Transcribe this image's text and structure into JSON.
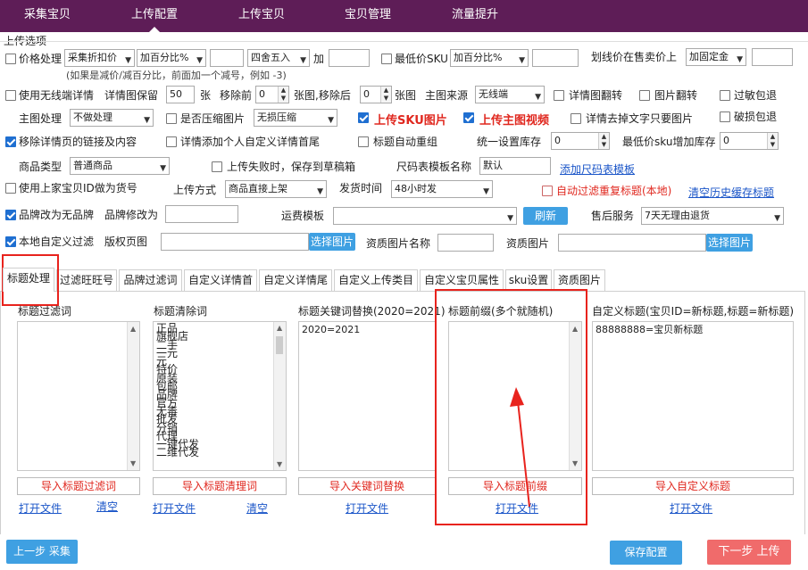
{
  "nav": {
    "tabs": [
      "采集宝贝",
      "上传配置",
      "上传宝贝",
      "宝贝管理",
      "流量提升"
    ],
    "active": 1
  },
  "section_title": "上传选项",
  "row1": {
    "price_label": "价格处理",
    "price_mode": "采集折扣价",
    "price_op": "加百分比%",
    "price_val": "",
    "rounding": "四舍五入",
    "add_label": "加",
    "add_val": "",
    "min_sku_label": "最低价SKU",
    "min_sku_op": "加百分比%",
    "min_sku_val": "",
    "strike_label": "划线价在售卖价上",
    "strike_mode": "加固定金",
    "strike_val": "",
    "hint": "(如果是减价/减百分比，前面加一个减号，例如 -3)"
  },
  "row2": {
    "wireless_label": "使用无线端详情",
    "keep_label": "详情图保留",
    "keep_val": "50",
    "zhang1": "张",
    "remove_front_label": "移除前",
    "remove_front_val": "0",
    "remove_back_label": "张图,移除后",
    "remove_back_val": "0",
    "zhang2": "张图",
    "main_src_label": "主图来源",
    "main_src": "无线端",
    "flip_detail_label": "详情图翻转",
    "flip_img_label": "图片翻转",
    "sensitive_label": "过敏包退"
  },
  "row3": {
    "main_proc_label": "主图处理",
    "main_proc": "不做处理",
    "compress_label": "是否压缩图片",
    "compress": "无损压缩",
    "sku_img_label": "上传SKU图片",
    "video_label": "上传主图视频",
    "text_only_label": "详情去掉文字只要图片",
    "damage_label": "破损包退"
  },
  "row4": {
    "remove_links_label": "移除详情页的链接及内容",
    "custom_first_label": "详情添加个人自定义详情首尾",
    "auto_regroup_label": "标题自动重组",
    "unify_stock_label": "统一设置库存",
    "unify_stock_val": "0",
    "min_sku_stock_label": "最低价sku增加库存",
    "min_sku_stock_val": "0"
  },
  "row5": {
    "type_label": "商品类型",
    "type": "普通商品",
    "draft_label": "上传失败时，保存到草稿箱",
    "size_tpl_label": "尺码表模板名称",
    "size_tpl_val": "默认",
    "add_size_link": "添加尺码表模板"
  },
  "row6": {
    "prev_id_label": "使用上家宝贝ID做为货号",
    "method_label": "上传方式",
    "method": "商品直接上架",
    "ship_label": "发货时间",
    "ship": "48小时发",
    "auto_filter_label": "自动过滤重复标题(本地)",
    "clear_cache_link": "清空历史缓存标题"
  },
  "row7": {
    "brand_none_label": "品牌改为无品牌",
    "brand_edit_label": "品牌修改为",
    "brand_edit_val": "",
    "freight_label": "运费模板",
    "freight": "",
    "refresh": "刷新",
    "after_sale_label": "售后服务",
    "after_sale": "7天无理由退货"
  },
  "row8": {
    "local_filter_label": "本地自定义过滤",
    "copyright_label": "版权页图",
    "choose1": "选择图片",
    "qual_name_label": "资质图片名称",
    "qual_name_val": "",
    "qual_img_label": "资质图片",
    "choose2": "选择图片"
  },
  "tabs": [
    "标题处理",
    "过滤旺旺号",
    "品牌过滤词",
    "自定义详情首",
    "自定义详情尾",
    "自定义上传类目",
    "自定义宝贝属性",
    "sku设置",
    "资质图片"
  ],
  "columns": [
    {
      "title": "标题过滤词",
      "lines": [],
      "import": "导入标题过滤词",
      "open": "打开文件",
      "clear": "清空"
    },
    {
      "title": "标题清除词",
      "lines": [
        "正品",
        "旗舰店",
        "二手",
        "一元",
        "元",
        "特价",
        "原装",
        "包邮",
        "品牌",
        "官方",
        "无毒",
        "批发",
        "分销",
        "代理",
        "一键代发",
        "二维代发"
      ],
      "import": "导入标题清理词",
      "open": "打开文件",
      "clear": "清空"
    },
    {
      "title": "标题关键词替换(2020=2021)",
      "lines": [
        "2020=2021"
      ],
      "import": "导入关键词替换",
      "open": "打开文件"
    },
    {
      "title": "标题前缀(多个就随机)",
      "lines": [],
      "import": "导入标题前缀",
      "open": "打开文件"
    },
    {
      "title": "自定义标题(宝贝ID=新标题,标题=新标题)",
      "lines": [
        "88888888=宝贝新标题"
      ],
      "import": "导入自定义标题",
      "open": "打开文件"
    }
  ],
  "footer": {
    "prev": "上一步 采集",
    "save": "保存配置",
    "next": "下一步 上传"
  }
}
